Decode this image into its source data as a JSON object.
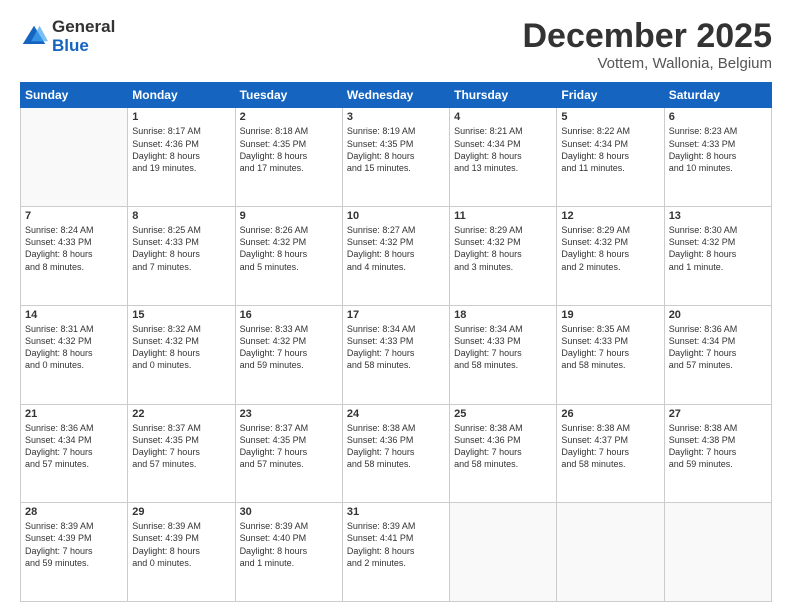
{
  "logo": {
    "general": "General",
    "blue": "Blue"
  },
  "header": {
    "month": "December 2025",
    "location": "Vottem, Wallonia, Belgium"
  },
  "days": [
    "Sunday",
    "Monday",
    "Tuesday",
    "Wednesday",
    "Thursday",
    "Friday",
    "Saturday"
  ],
  "weeks": [
    [
      {
        "day": "",
        "content": ""
      },
      {
        "day": "1",
        "content": "Sunrise: 8:17 AM\nSunset: 4:36 PM\nDaylight: 8 hours\nand 19 minutes."
      },
      {
        "day": "2",
        "content": "Sunrise: 8:18 AM\nSunset: 4:35 PM\nDaylight: 8 hours\nand 17 minutes."
      },
      {
        "day": "3",
        "content": "Sunrise: 8:19 AM\nSunset: 4:35 PM\nDaylight: 8 hours\nand 15 minutes."
      },
      {
        "day": "4",
        "content": "Sunrise: 8:21 AM\nSunset: 4:34 PM\nDaylight: 8 hours\nand 13 minutes."
      },
      {
        "day": "5",
        "content": "Sunrise: 8:22 AM\nSunset: 4:34 PM\nDaylight: 8 hours\nand 11 minutes."
      },
      {
        "day": "6",
        "content": "Sunrise: 8:23 AM\nSunset: 4:33 PM\nDaylight: 8 hours\nand 10 minutes."
      }
    ],
    [
      {
        "day": "7",
        "content": "Sunrise: 8:24 AM\nSunset: 4:33 PM\nDaylight: 8 hours\nand 8 minutes."
      },
      {
        "day": "8",
        "content": "Sunrise: 8:25 AM\nSunset: 4:33 PM\nDaylight: 8 hours\nand 7 minutes."
      },
      {
        "day": "9",
        "content": "Sunrise: 8:26 AM\nSunset: 4:32 PM\nDaylight: 8 hours\nand 5 minutes."
      },
      {
        "day": "10",
        "content": "Sunrise: 8:27 AM\nSunset: 4:32 PM\nDaylight: 8 hours\nand 4 minutes."
      },
      {
        "day": "11",
        "content": "Sunrise: 8:29 AM\nSunset: 4:32 PM\nDaylight: 8 hours\nand 3 minutes."
      },
      {
        "day": "12",
        "content": "Sunrise: 8:29 AM\nSunset: 4:32 PM\nDaylight: 8 hours\nand 2 minutes."
      },
      {
        "day": "13",
        "content": "Sunrise: 8:30 AM\nSunset: 4:32 PM\nDaylight: 8 hours\nand 1 minute."
      }
    ],
    [
      {
        "day": "14",
        "content": "Sunrise: 8:31 AM\nSunset: 4:32 PM\nDaylight: 8 hours\nand 0 minutes."
      },
      {
        "day": "15",
        "content": "Sunrise: 8:32 AM\nSunset: 4:32 PM\nDaylight: 8 hours\nand 0 minutes."
      },
      {
        "day": "16",
        "content": "Sunrise: 8:33 AM\nSunset: 4:32 PM\nDaylight: 7 hours\nand 59 minutes."
      },
      {
        "day": "17",
        "content": "Sunrise: 8:34 AM\nSunset: 4:33 PM\nDaylight: 7 hours\nand 58 minutes."
      },
      {
        "day": "18",
        "content": "Sunrise: 8:34 AM\nSunset: 4:33 PM\nDaylight: 7 hours\nand 58 minutes."
      },
      {
        "day": "19",
        "content": "Sunrise: 8:35 AM\nSunset: 4:33 PM\nDaylight: 7 hours\nand 58 minutes."
      },
      {
        "day": "20",
        "content": "Sunrise: 8:36 AM\nSunset: 4:34 PM\nDaylight: 7 hours\nand 57 minutes."
      }
    ],
    [
      {
        "day": "21",
        "content": "Sunrise: 8:36 AM\nSunset: 4:34 PM\nDaylight: 7 hours\nand 57 minutes."
      },
      {
        "day": "22",
        "content": "Sunrise: 8:37 AM\nSunset: 4:35 PM\nDaylight: 7 hours\nand 57 minutes."
      },
      {
        "day": "23",
        "content": "Sunrise: 8:37 AM\nSunset: 4:35 PM\nDaylight: 7 hours\nand 57 minutes."
      },
      {
        "day": "24",
        "content": "Sunrise: 8:38 AM\nSunset: 4:36 PM\nDaylight: 7 hours\nand 58 minutes."
      },
      {
        "day": "25",
        "content": "Sunrise: 8:38 AM\nSunset: 4:36 PM\nDaylight: 7 hours\nand 58 minutes."
      },
      {
        "day": "26",
        "content": "Sunrise: 8:38 AM\nSunset: 4:37 PM\nDaylight: 7 hours\nand 58 minutes."
      },
      {
        "day": "27",
        "content": "Sunrise: 8:38 AM\nSunset: 4:38 PM\nDaylight: 7 hours\nand 59 minutes."
      }
    ],
    [
      {
        "day": "28",
        "content": "Sunrise: 8:39 AM\nSunset: 4:39 PM\nDaylight: 7 hours\nand 59 minutes."
      },
      {
        "day": "29",
        "content": "Sunrise: 8:39 AM\nSunset: 4:39 PM\nDaylight: 8 hours\nand 0 minutes."
      },
      {
        "day": "30",
        "content": "Sunrise: 8:39 AM\nSunset: 4:40 PM\nDaylight: 8 hours\nand 1 minute."
      },
      {
        "day": "31",
        "content": "Sunrise: 8:39 AM\nSunset: 4:41 PM\nDaylight: 8 hours\nand 2 minutes."
      },
      {
        "day": "",
        "content": ""
      },
      {
        "day": "",
        "content": ""
      },
      {
        "day": "",
        "content": ""
      }
    ]
  ]
}
